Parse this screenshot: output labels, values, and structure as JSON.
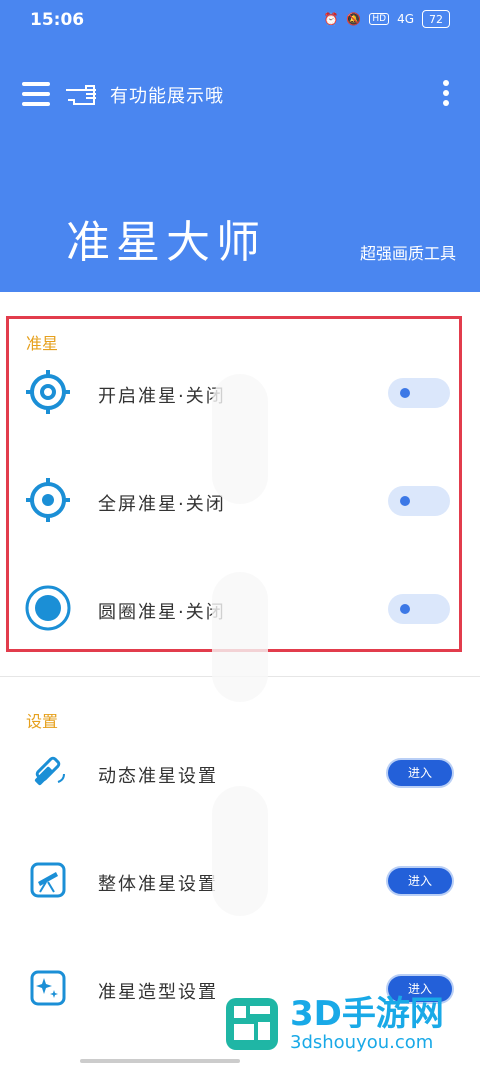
{
  "status": {
    "time": "15:06",
    "signal": "4G",
    "battery": "72"
  },
  "toolbar": {
    "title": "有功能展示哦"
  },
  "header": {
    "app_title": "准星大师",
    "subtitle": "超强画质工具"
  },
  "crosshair_section": {
    "title": "准星",
    "items": [
      {
        "label": "开启准星·关闭",
        "icon": "crosshair-ring-icon"
      },
      {
        "label": "全屏准星·关闭",
        "icon": "crosshair-dot-icon"
      },
      {
        "label": "圆圈准星·关闭",
        "icon": "circle-dot-icon"
      }
    ]
  },
  "settings_section": {
    "title": "设置",
    "items": [
      {
        "label": "动态准星设置",
        "button": "进入",
        "icon": "satellite-icon"
      },
      {
        "label": "整体准星设置",
        "button": "进入",
        "icon": "telescope-icon"
      },
      {
        "label": "准星造型设置",
        "button": "进入",
        "icon": "sparkle-icon"
      }
    ]
  },
  "watermark": {
    "main": "3D手游网",
    "sub": "3dshouyou.com"
  },
  "colors": {
    "header_bg": "#4a86f0",
    "accent": "#2360d9",
    "section_title": "#e6a01d",
    "highlight_border": "#e23c4c"
  }
}
